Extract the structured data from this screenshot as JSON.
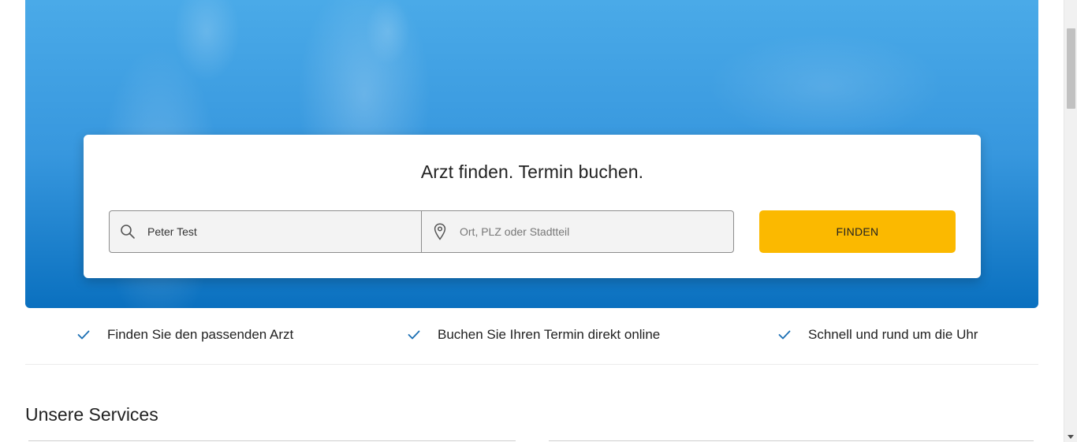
{
  "hero": {
    "title": "Arzt finden. Termin buchen.",
    "search": {
      "name_value": "Peter Test",
      "name_placeholder": "",
      "location_value": "",
      "location_placeholder": "Ort, PLZ oder Stadtteil",
      "button_label": "FINDEN"
    }
  },
  "features": [
    {
      "label": "Finden Sie den passenden Arzt"
    },
    {
      "label": "Buchen Sie Ihren Termin direkt online"
    },
    {
      "label": "Schnell und rund um die Uhr"
    }
  ],
  "services": {
    "title": "Unsere Services"
  },
  "icons": {
    "search": "search-icon",
    "location": "location-pin-icon",
    "check": "check-icon"
  },
  "colors": {
    "hero_top": "#4aaae8",
    "hero_bottom": "#0a70bf",
    "button": "#fbb900",
    "check": "#1b6fb3"
  }
}
